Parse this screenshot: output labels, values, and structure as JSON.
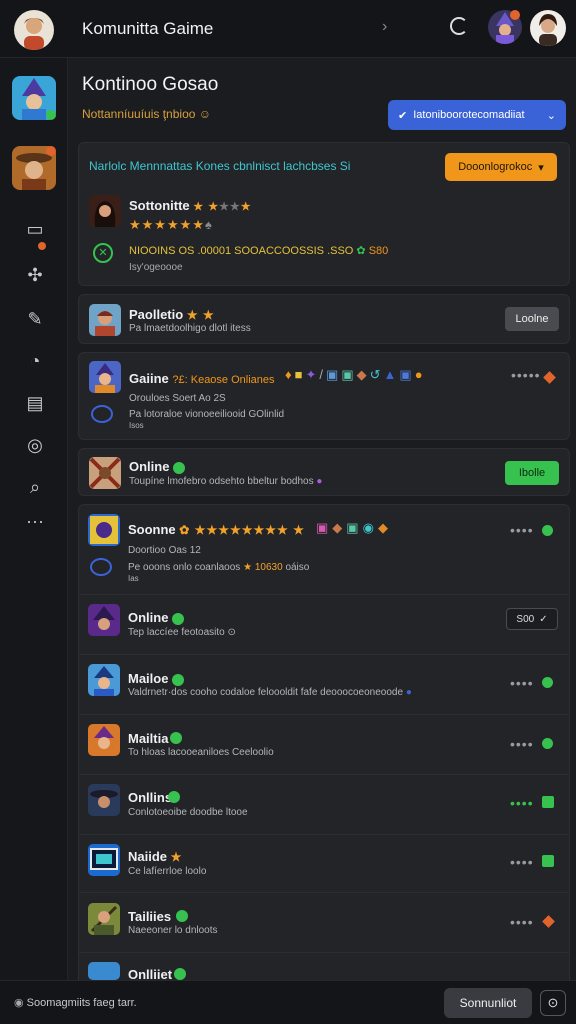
{
  "header": {
    "title": "Komunitta Gaime"
  },
  "page": {
    "title": "Kontinoo Gosao",
    "subtitle": "Nottanníuuíuis ţnbioo",
    "filter_button": "Iatoniboorotecomadiiat"
  },
  "featured": {
    "banner": "Narlolc Mennnattas Kones cbnlnisct lachcbses Si",
    "action_button": "Dooonlogrokoc",
    "game_title": "Sottonitte",
    "stats_line": "NIOOINS OS .00001 SOOACCOOSSIS .SSO",
    "stats_highlight": "S80",
    "footnote": "Isy'ogeoooe"
  },
  "game_rows": [
    {
      "title": "Paolletio",
      "subtitle": "Pa lmaetdoolhigo dlotl itess",
      "button": "Loolne"
    },
    {
      "title": "Gaiine",
      "highlight": "Keaose Onlianes",
      "subtitle": "Orouloes Soert Ao 2S",
      "subtitle2": "Pa lotoraloe vionoeeiliooid GOlinlid",
      "subtitle3": "Isos"
    },
    {
      "title": "Online",
      "subtitle": "Toupíne lmofebro odsehto bbeltur bodhos",
      "button": "Ibolle"
    },
    {
      "title": "Soonne",
      "subtitle": "Doortioo Oas 12",
      "subtitle2": "Pe ooons onlo coanlaoos",
      "highlight": "10630",
      "subtitle3": "oáiso"
    },
    {
      "title": "Online",
      "subtitle": "Tep laccíee feotoasito",
      "button": "S00"
    },
    {
      "title": "Mailoe",
      "subtitle": "Valdrnetr·dos cooho codaloe feloooldit fafe deooocoeoneoode"
    },
    {
      "title": "Mailtia",
      "subtitle": "To hloas lacooeaniloes Ceeloolio"
    },
    {
      "title": "Onllins",
      "subtitle": "Conlotoeoibe doodbe ltooe"
    },
    {
      "title": "Naiide",
      "subtitle": "Ce lafíerrloe loolo"
    },
    {
      "title": "Tailiies",
      "subtitle": "Naeeoner lo dnloots"
    },
    {
      "title": "Onlliiet",
      "subtitle": ""
    }
  ],
  "footer": {
    "status": "Soomagmiits faeg tarr.",
    "submit_button": "Sonnunliot"
  },
  "colors": {
    "accent_blue": "#3b63d8",
    "accent_orange": "#f0961a",
    "online_green": "#37c24f",
    "star_gold": "#f2a22a"
  }
}
